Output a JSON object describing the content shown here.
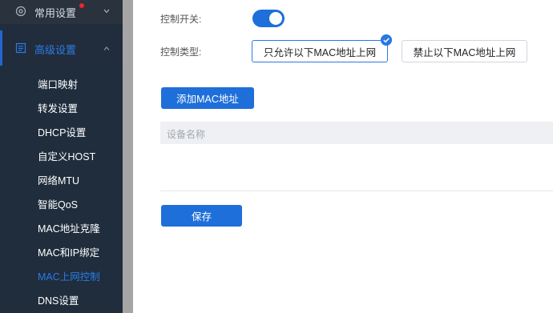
{
  "sidebar": {
    "common_settings": {
      "label": "常用设置",
      "icon": "gear-icon",
      "has_notification": true
    },
    "advanced_settings": {
      "label": "高级设置",
      "icon": "document-icon",
      "expanded": true
    },
    "items": [
      {
        "label": "端口映射"
      },
      {
        "label": "转发设置"
      },
      {
        "label": "DHCP设置"
      },
      {
        "label": "自定义HOST"
      },
      {
        "label": "网络MTU"
      },
      {
        "label": "智能QoS"
      },
      {
        "label": "MAC地址克隆"
      },
      {
        "label": "MAC和IP绑定"
      },
      {
        "label": "MAC上网控制",
        "active": true
      },
      {
        "label": "DNS设置"
      }
    ]
  },
  "main": {
    "control_switch": {
      "label": "控制开关:",
      "on": true
    },
    "control_type": {
      "label": "控制类型:",
      "options": [
        {
          "label": "只允许以下MAC地址上网",
          "selected": true
        },
        {
          "label": "禁止以下MAC地址上网",
          "selected": false
        }
      ]
    },
    "add_mac_button": "添加MAC地址",
    "table": {
      "columns": [
        "设备名称"
      ],
      "rows": []
    },
    "save_button": "保存"
  },
  "colors": {
    "sidebar_bg": "#1f2d3d",
    "accent": "#1e6fd9",
    "active_text": "#2c7be5",
    "notification": "#ee2330"
  }
}
